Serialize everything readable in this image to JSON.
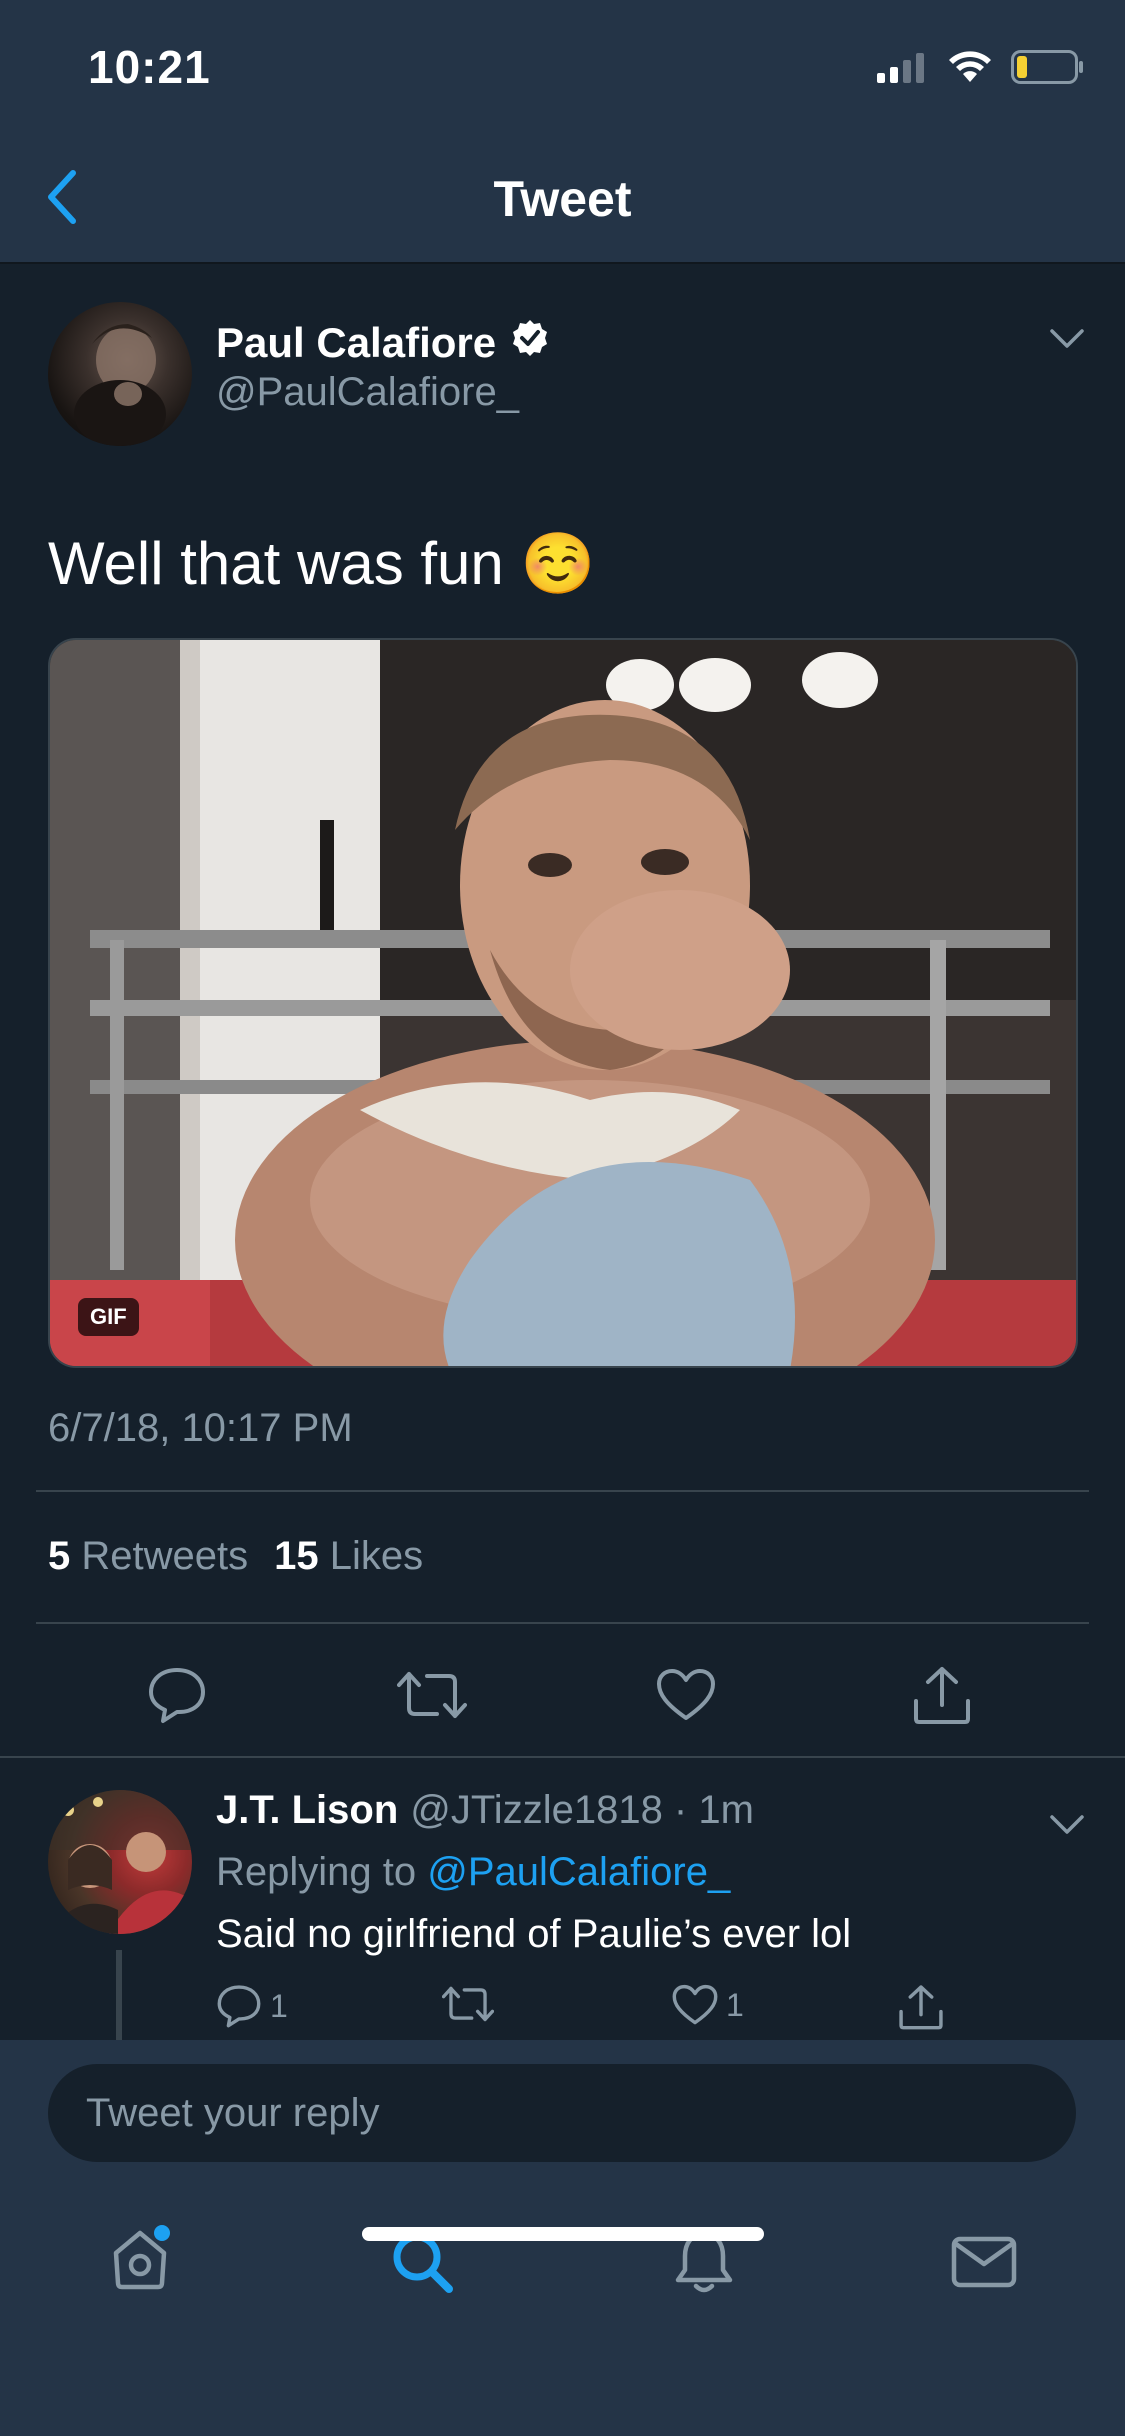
{
  "status_bar": {
    "time": "10:21"
  },
  "nav": {
    "title": "Tweet"
  },
  "tweet": {
    "author_name": "Paul Calafiore",
    "author_handle": "@PaulCalafiore_",
    "text": "Well that was fun ☺️",
    "media_badge": "GIF",
    "timestamp": "6/7/18, 10:17 PM",
    "retweets_count": "5",
    "retweets_label": "Retweets",
    "likes_count": "15",
    "likes_label": "Likes"
  },
  "reply": {
    "author_name": "J.T. Lison",
    "meta": "@JTizzle1818 · 1m",
    "replying_prefix": "Replying to",
    "replying_mention": "@PaulCalafiore_",
    "text": "Said no girlfriend of Paulie’s ever lol",
    "reply_count": "1",
    "like_count": "1"
  },
  "compose": {
    "placeholder": "Tweet your reply"
  },
  "colors": {
    "background": "#15202b",
    "bar": "#243447",
    "accent": "#1da1f2",
    "secondary_text": "#8899a6",
    "battery_low": "#f5d033"
  },
  "icons": {
    "status": [
      "cellular-signal-icon",
      "wifi-icon",
      "battery-icon"
    ],
    "tweet_actions": [
      "reply-icon",
      "retweet-icon",
      "like-icon",
      "share-icon"
    ],
    "tabs": [
      "home-icon",
      "search-icon",
      "notifications-icon",
      "messages-icon"
    ]
  }
}
